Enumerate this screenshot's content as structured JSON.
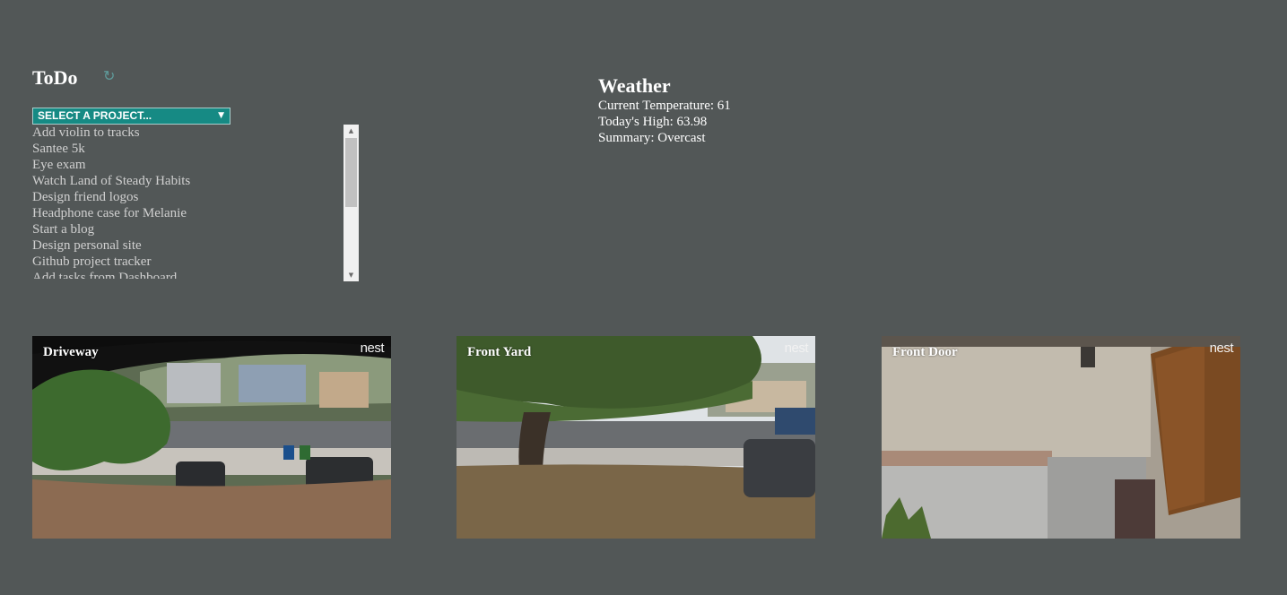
{
  "todo": {
    "title": "ToDo",
    "refresh_icon": "refresh-icon",
    "project_select": {
      "selected": "SELECT A PROJECT..."
    },
    "tasks": [
      "Add violin to tracks",
      "Santee 5k",
      "Eye exam",
      "Watch Land of Steady Habits",
      "Design friend logos",
      "Headphone case for Melanie",
      "Start a blog",
      "Design personal site",
      "Github project tracker",
      "Add tasks from Dashboard"
    ]
  },
  "weather": {
    "title": "Weather",
    "current_temperature": "Current Temperature: 61",
    "todays_high": "Today's High: 63.98",
    "summary": "Summary: Overcast"
  },
  "cameras": [
    {
      "label": "Driveway",
      "logo": "nest"
    },
    {
      "label": "Front Yard",
      "logo": "nest"
    },
    {
      "label": "Front Door",
      "logo": "nest"
    }
  ],
  "colors": {
    "background": "#525757",
    "select_accent": "#168a84",
    "task_text": "#d0d0d0"
  }
}
